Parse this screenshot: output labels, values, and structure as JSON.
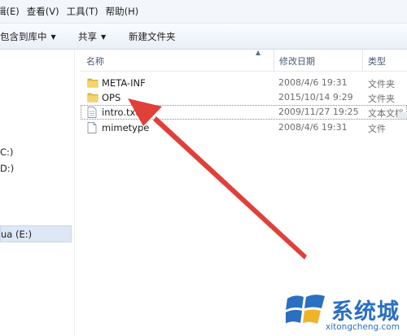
{
  "menu": {
    "items": [
      {
        "label": "辑(E)"
      },
      {
        "label": "查看(V)"
      },
      {
        "label": "工具(T)"
      },
      {
        "label": "帮助(H)"
      }
    ]
  },
  "toolbar": {
    "library_label": "包含到库中",
    "share_label": "共享",
    "new_folder_label": "新建文件夹"
  },
  "nav": {
    "drives": [
      {
        "label": "C:)"
      },
      {
        "label": "D:)"
      },
      {
        "label": "ua (E:)"
      }
    ]
  },
  "columns": {
    "name": "名称",
    "date": "修改日期",
    "type": "类型"
  },
  "files": [
    {
      "name": "META-INF",
      "date": "2008/4/6 19:31",
      "type": "文件夹",
      "icon": "folder-icon"
    },
    {
      "name": "OPS",
      "date": "2015/10/14 9:29",
      "type": "文件夹",
      "icon": "folder-icon"
    },
    {
      "name": "intro.txt",
      "date": "2009/11/27 19:25",
      "type": "文本文档",
      "icon": "text-file-icon"
    },
    {
      "name": "mimetype",
      "date": "2008/4/6 19:31",
      "type": "文件",
      "icon": "file-icon"
    }
  ],
  "watermark": {
    "brand": "系统城",
    "url": "xitongcheng.com"
  },
  "colors": {
    "arrow": "#e0403a",
    "folder": "#e8c24a",
    "brand": "#2a6fc1"
  }
}
